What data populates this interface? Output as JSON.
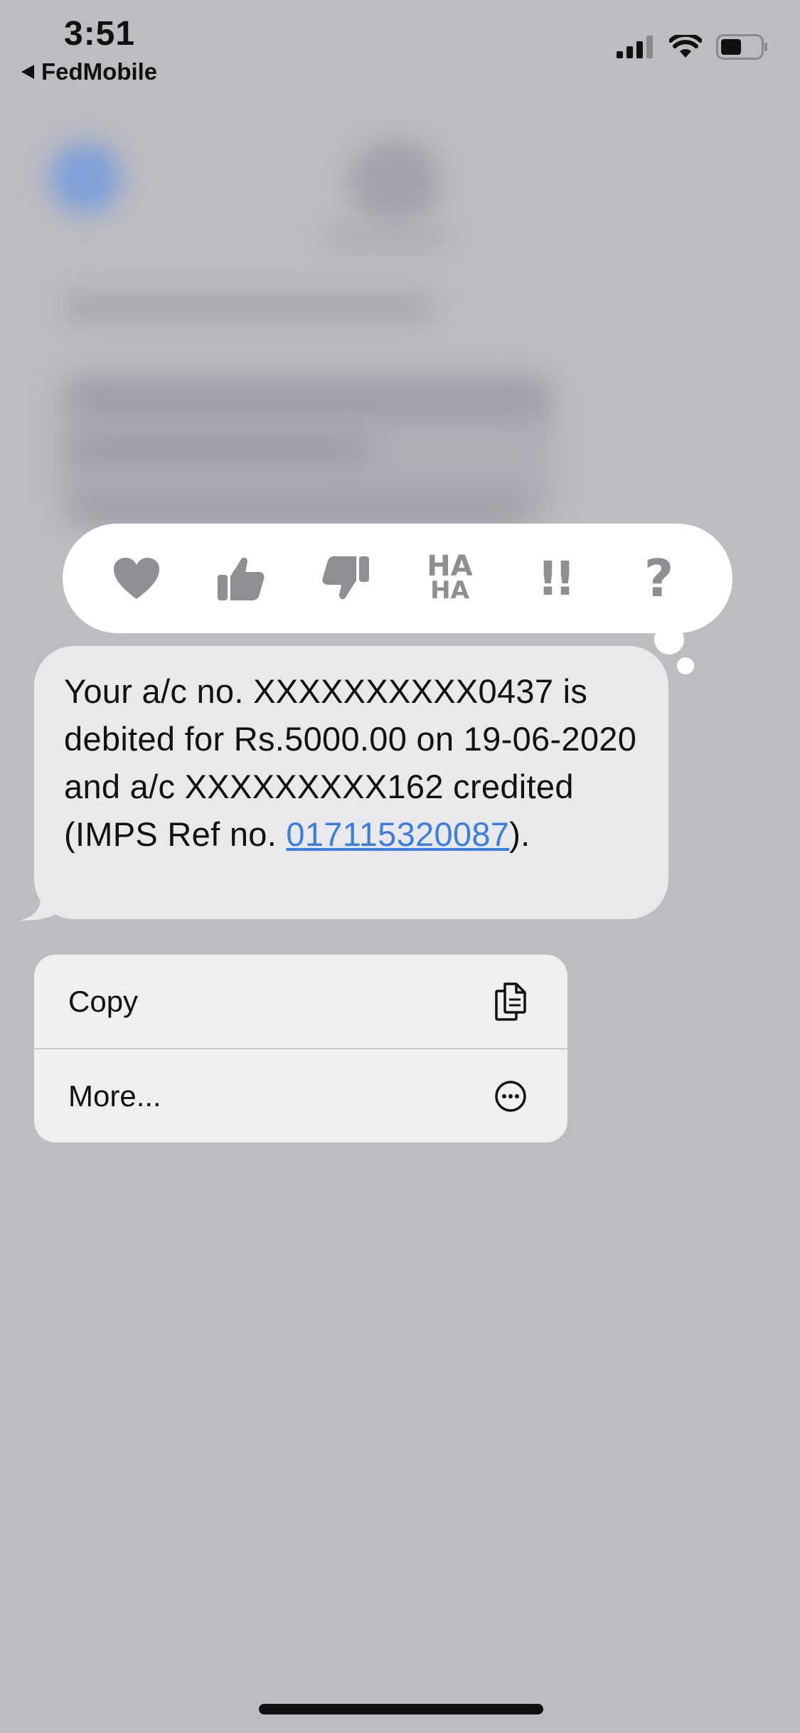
{
  "status_bar": {
    "time": "3:51",
    "back_app": "FedMobile",
    "icons": [
      "signal-icon",
      "wifi-icon",
      "battery-icon"
    ]
  },
  "tapbacks": [
    {
      "name": "heart",
      "icon": "heart-icon"
    },
    {
      "name": "thumbs-up",
      "icon": "thumbs-up-icon"
    },
    {
      "name": "thumbs-down",
      "icon": "thumbs-down-icon"
    },
    {
      "name": "haha",
      "line1": "HA",
      "line2": "HA"
    },
    {
      "name": "exclamation",
      "text": "!!"
    },
    {
      "name": "question",
      "text": "?"
    }
  ],
  "message": {
    "text_before_link": "Your a/c no. XXXXXXXXXX0437 is debited for Rs.5000.00 on 19-06-2020 and a/c XXXXXXXXX162 credited (IMPS Ref no. ",
    "link": "017115320087",
    "text_after_link": ")."
  },
  "menu": {
    "items": [
      {
        "label": "Copy",
        "icon": "copy-icon"
      },
      {
        "label": "More...",
        "icon": "more-ellipsis-icon"
      }
    ]
  },
  "colors": {
    "background": "#bdbcc1",
    "bubble": "#e9e9eb",
    "link": "#3a7ee2",
    "tapback_icon": "#8e8e93"
  }
}
